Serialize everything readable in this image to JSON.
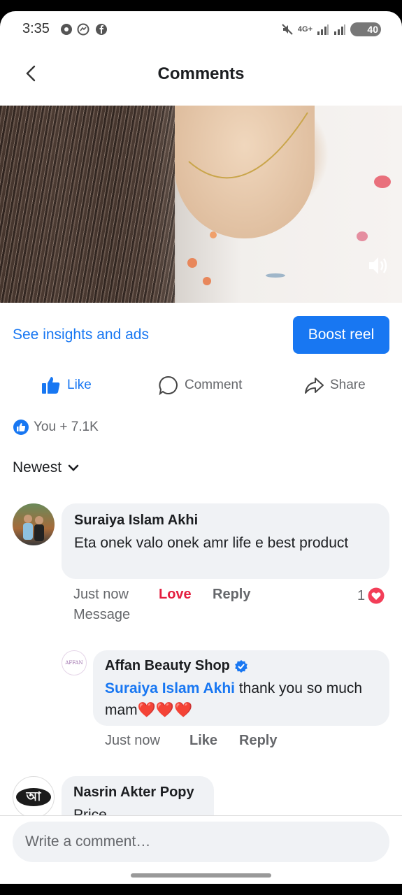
{
  "status_bar": {
    "time": "3:35",
    "network": "4G+",
    "battery": "40"
  },
  "header": {
    "title": "Comments"
  },
  "actions": {
    "insights_label": "See insights and ads",
    "boost_label": "Boost reel",
    "like_label": "Like",
    "comment_label": "Comment",
    "share_label": "Share"
  },
  "reactions": {
    "summary": "You + 7.1K"
  },
  "sort": {
    "label": "Newest"
  },
  "comments": [
    {
      "author": "Suraiya Islam Akhi",
      "text": "Eta onek valo onek amr life e best product",
      "time": "Just now",
      "love_label": "Love",
      "reply_label": "Reply",
      "message_label": "Message",
      "reaction_count": "1"
    },
    {
      "author": "Affan Beauty Shop",
      "mention": "Suraiya Islam Akhi",
      "text": " thank you so much mam❤️❤️❤️",
      "time": "Just now",
      "like_label": "Like",
      "reply_label": "Reply",
      "avatar_text": "AFFAN"
    },
    {
      "author": "Nasrin Akter Popy",
      "text": "Price",
      "avatar_text": "আ"
    }
  ],
  "composer": {
    "placeholder": "Write a comment…"
  },
  "colors": {
    "accent": "#1877f2",
    "love": "#e41e3f",
    "bubble": "#f0f2f5"
  }
}
